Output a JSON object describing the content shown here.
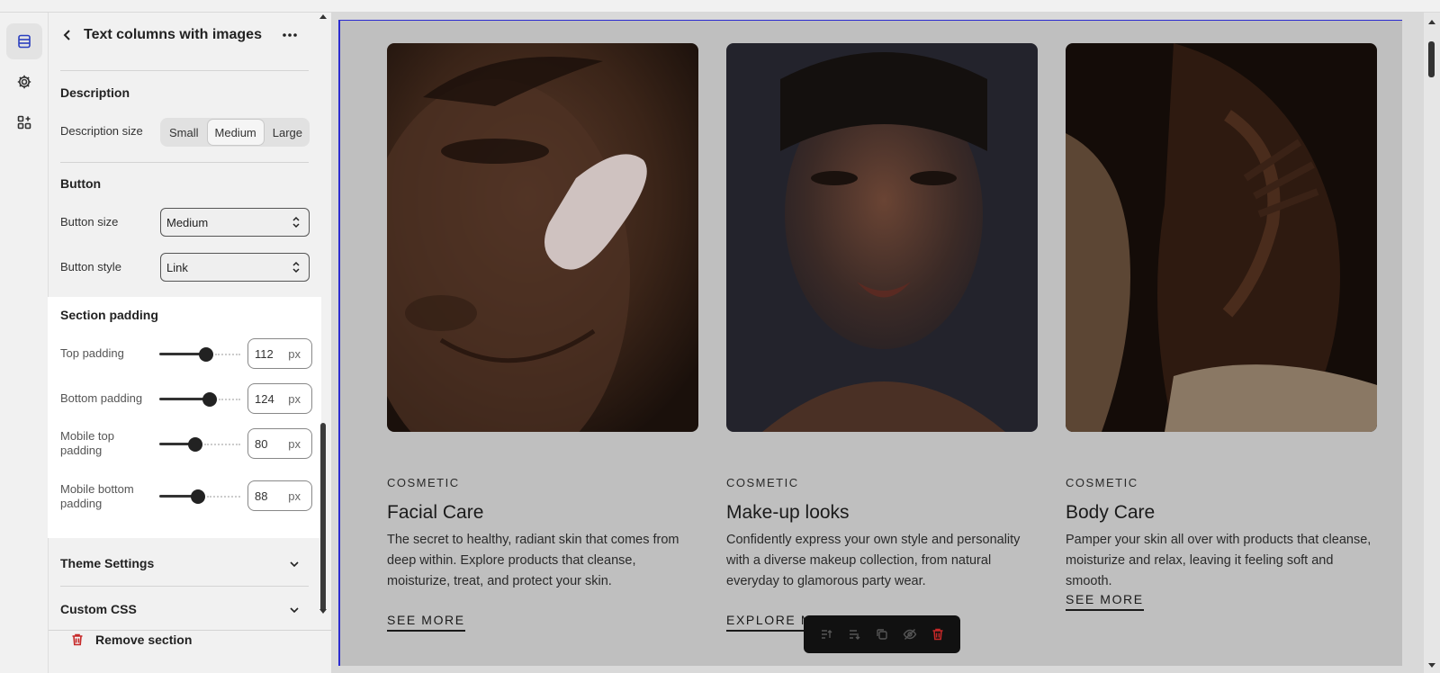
{
  "panel": {
    "title": "Text columns with images",
    "description": {
      "heading": "Description",
      "size_label": "Description size",
      "size_options": [
        "Small",
        "Medium",
        "Large"
      ],
      "size_selected": "Medium"
    },
    "button": {
      "heading": "Button",
      "size_label": "Button size",
      "size_value": "Medium",
      "style_label": "Button style",
      "style_value": "Link"
    },
    "section_padding": {
      "heading": "Section padding",
      "unit": "px",
      "rows": [
        {
          "label": "Top padding",
          "value": "112",
          "fraction": 0.56
        },
        {
          "label": "Bottom padding",
          "value": "124",
          "fraction": 0.61
        },
        {
          "label": "Mobile top padding",
          "value": "80",
          "fraction": 0.42
        },
        {
          "label": "Mobile bottom padding",
          "value": "88",
          "fraction": 0.45
        }
      ]
    },
    "theme_settings": "Theme Settings",
    "custom_css": "Custom CSS",
    "remove_section": "Remove section"
  },
  "preview": {
    "cards": [
      {
        "tag": "COSMETIC",
        "title": "Facial Care",
        "description": "The secret to healthy, radiant skin that comes from deep within. Explore products that cleanse, moisturize, treat, and protect your skin.",
        "link": "SEE MORE"
      },
      {
        "tag": "COSMETIC",
        "title": "Make-up looks",
        "description": "Confidently express your own style and personality with a diverse makeup collection, from natural everyday to glamorous party wear.",
        "link": "EXPLORE MAKEUP"
      },
      {
        "tag": "COSMETIC",
        "title": "Body Care",
        "description": "Pamper your skin all over with products that cleanse, moisturize and relax, leaving it feeling soft and smooth.",
        "link": "SEE MORE"
      }
    ]
  },
  "icons": {
    "rail": [
      "sections-icon",
      "settings-gear-icon",
      "apps-add-icon"
    ],
    "toolbar": [
      "move-up-icon",
      "move-down-icon",
      "duplicate-icon",
      "hide-icon",
      "delete-icon"
    ]
  },
  "colors": {
    "accent_blue": "#2b2bd0",
    "delete_red": "#c62828",
    "panel_bg": "#f1f1f1"
  }
}
